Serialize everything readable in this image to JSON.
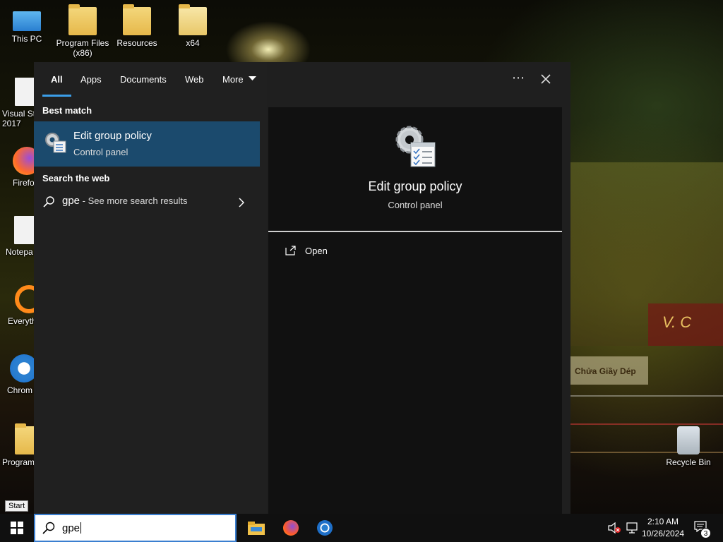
{
  "desktop": {
    "icons": [
      {
        "label": "This PC"
      },
      {
        "label": "Program Files\n(x86)"
      },
      {
        "label": "Resources"
      },
      {
        "label": "x64"
      },
      {
        "label": "Visual St\n2017"
      },
      {
        "label": "Firefo"
      },
      {
        "label": "Notepa"
      },
      {
        "label": "Everyth"
      },
      {
        "label": "Chrom"
      },
      {
        "label": "Program"
      },
      {
        "label": "Recycle Bin"
      }
    ],
    "wallpaper_sign": "Chửa Giầy Dép",
    "wallpaper_redsign": "V. C"
  },
  "search_panel": {
    "tabs": [
      {
        "label": "All",
        "active": true
      },
      {
        "label": "Apps"
      },
      {
        "label": "Documents"
      },
      {
        "label": "Web"
      },
      {
        "label": "More"
      }
    ],
    "more_options_icon": "ellipsis-icon",
    "close_icon": "close-icon",
    "best_match_heading": "Best match",
    "best_match": {
      "title": "Edit group policy",
      "subtitle": "Control panel",
      "icon": "group-policy-icon"
    },
    "search_web_heading": "Search the web",
    "web_result": {
      "query": "gpe",
      "suffix": " - See more search results"
    },
    "detail": {
      "title": "Edit group policy",
      "subtitle": "Control panel",
      "actions": [
        {
          "label": "Open",
          "icon": "open-external-icon"
        }
      ]
    }
  },
  "taskbar": {
    "start_tooltip": "Start",
    "search_value": "gpe",
    "pinned_apps": [
      "file-explorer-icon",
      "firefox-icon",
      "chrome-icon"
    ],
    "clock_time": "2:10 AM",
    "clock_date": "10/26/2024",
    "notification_count": "3"
  },
  "colors": {
    "accent": "#3b9ee8",
    "selection": "#1b4a6d",
    "panel_bg": "#202020",
    "detail_bg": "#111111",
    "taskbar_bg": "#101010"
  }
}
